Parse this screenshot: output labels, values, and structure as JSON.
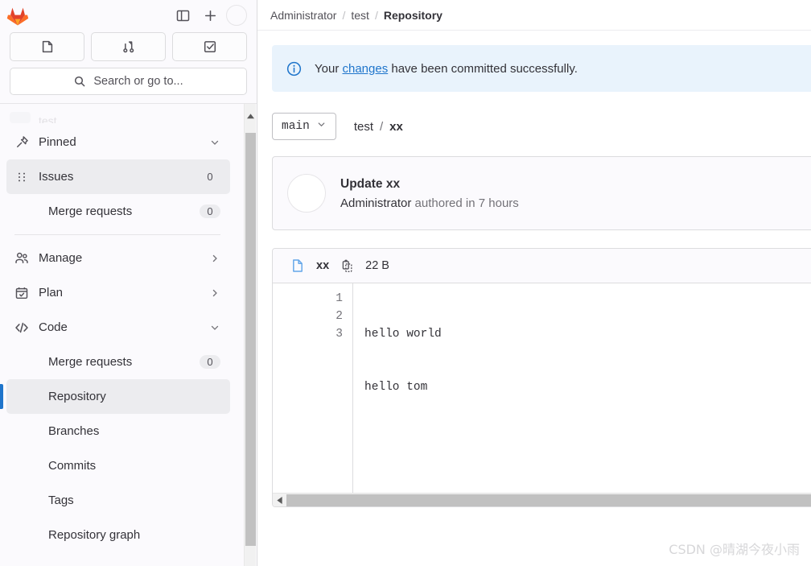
{
  "sidebar": {
    "logo": "gitlab-logo",
    "top_actions": [
      {
        "name": "sidebar-toggle-icon",
        "label": "Toggle sidebar"
      },
      {
        "name": "create-new-icon",
        "label": "Create new"
      },
      {
        "name": "user-avatar",
        "label": ""
      }
    ],
    "quick_buttons": [
      {
        "name": "issues-shortcut",
        "icon": "issues-icon",
        "label": "Issues"
      },
      {
        "name": "merge-requests-shortcut",
        "icon": "merge-request-icon",
        "label": "Merge requests"
      },
      {
        "name": "todo-shortcut",
        "icon": "todo-check-icon",
        "label": "To-Do List"
      }
    ],
    "search": {
      "placeholder": "Search or go to...",
      "icon": "search-icon"
    },
    "pinned": {
      "label": "Pinned",
      "icon": "pin-icon",
      "chevron": "chevron-down-icon"
    },
    "pinned_items": [
      {
        "label": "Issues",
        "badge": "0",
        "icon": "drag-handle-icon",
        "state": "hovered"
      },
      {
        "label": "Merge requests",
        "badge": "0",
        "icon": "",
        "state": ""
      }
    ],
    "sections": [
      {
        "label": "Manage",
        "icon": "users-icon",
        "chevron": "chevron-right-icon"
      },
      {
        "label": "Plan",
        "icon": "calendar-icon",
        "chevron": "chevron-right-icon"
      },
      {
        "label": "Code",
        "icon": "code-brackets-icon",
        "chevron": "chevron-down-icon"
      }
    ],
    "code_items": [
      {
        "label": "Merge requests",
        "badge": "0",
        "state": ""
      },
      {
        "label": "Repository",
        "badge": "",
        "state": "active"
      },
      {
        "label": "Branches",
        "badge": "",
        "state": ""
      },
      {
        "label": "Commits",
        "badge": "",
        "state": ""
      },
      {
        "label": "Tags",
        "badge": "",
        "state": ""
      },
      {
        "label": "Repository graph",
        "badge": "",
        "state": ""
      }
    ]
  },
  "breadcrumb": {
    "owner": "Administrator",
    "project": "test",
    "section": "Repository",
    "separator": "/"
  },
  "alert": {
    "icon": "info-circle-icon",
    "prefix": "Your ",
    "link": "changes",
    "suffix": " have been committed successfully."
  },
  "repo": {
    "branch": "main",
    "branch_chevron": "chevron-down-icon",
    "path_root": "test",
    "path_sep": "/",
    "path_file": "xx"
  },
  "commit": {
    "title": "Update xx",
    "author": "Administrator",
    "meta": " authored in 7 hours",
    "avatar": "commit-author-avatar"
  },
  "file": {
    "doc_icon": "file-document-icon",
    "name": "xx",
    "copy_icon": "copy-path-icon",
    "size": "22 B",
    "lines": [
      {
        "number": "1",
        "text": "hello world"
      },
      {
        "number": "2",
        "text": "hello tom"
      },
      {
        "number": "3",
        "text": ""
      }
    ]
  },
  "watermark": "CSDN @晴湖今夜小雨",
  "colors": {
    "accent": "#1f75cb",
    "alert_bg": "#e9f3fc",
    "sidebar_bg": "#fbfafd",
    "active_bg": "#ececef",
    "file_icon": "#63a6e9"
  }
}
